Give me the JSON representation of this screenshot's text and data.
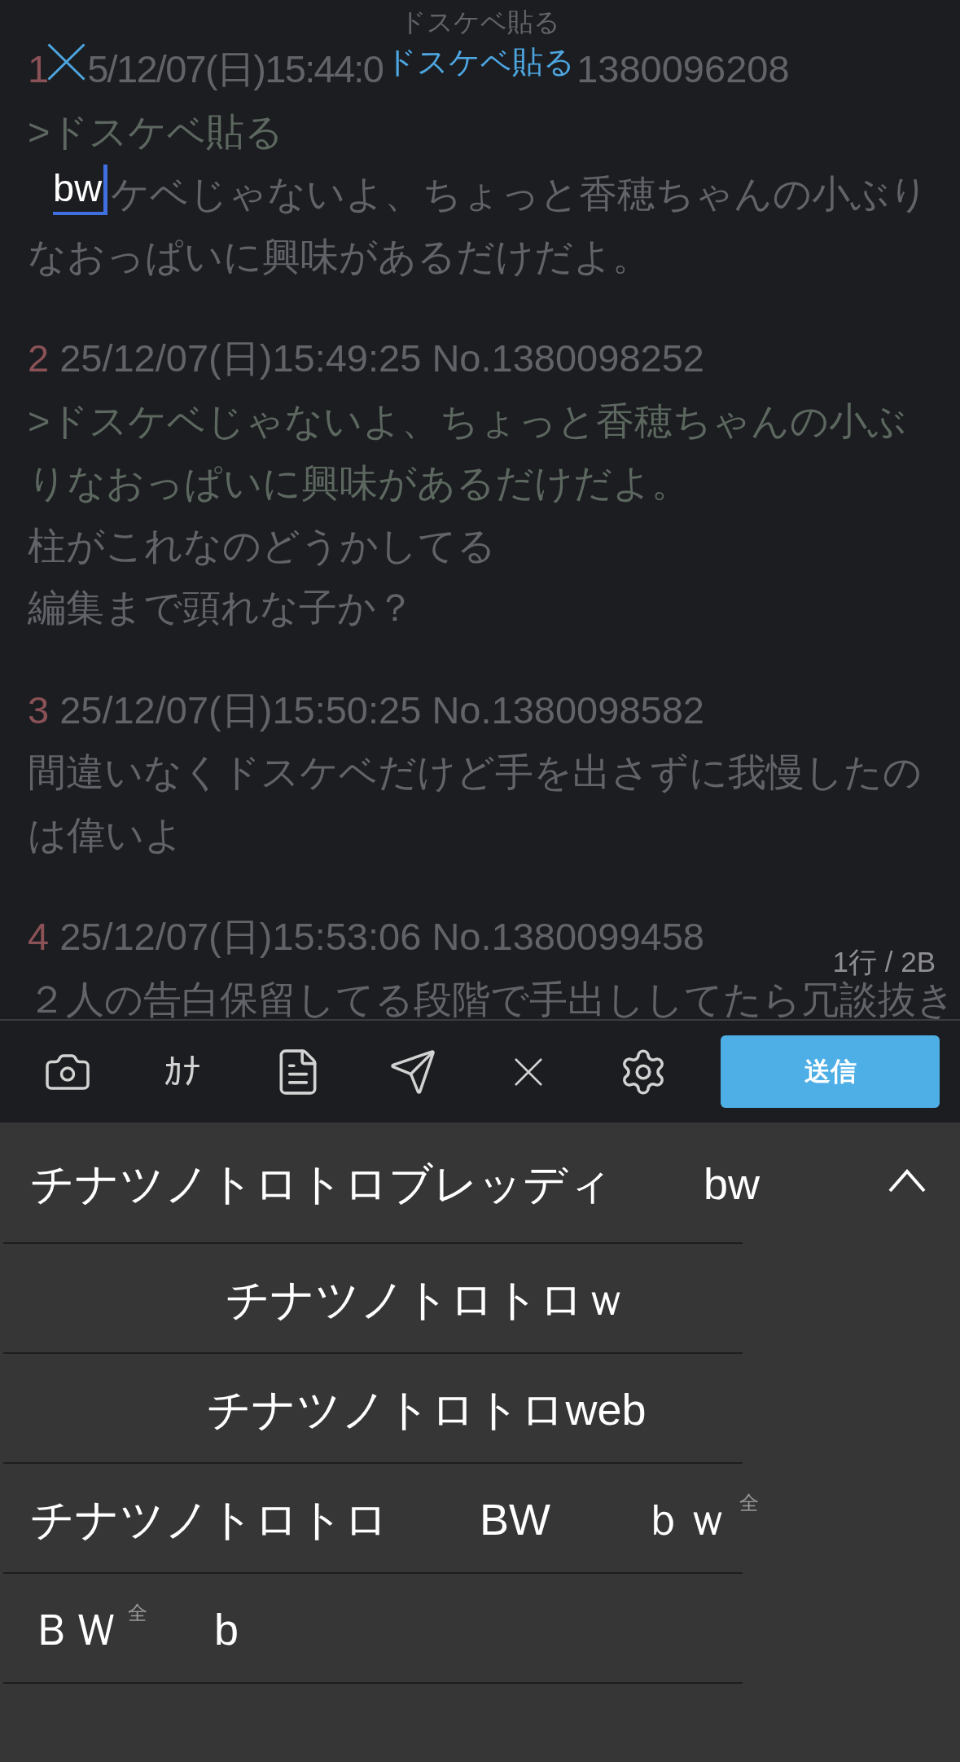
{
  "thread": {
    "title": "ドスケベ貼る",
    "posts": [
      {
        "number": "1",
        "info": [
          "5/12/07(日)15:44:0",
          "1380096208"
        ],
        "lines": [
          {
            "kind": "quote",
            "text": ">ドスケベ貼る"
          },
          {
            "kind": "text",
            "text": "ケベじゃないよ、ちょっと香穂ちゃんの小ぶり"
          },
          {
            "kind": "text",
            "text": "なおっぱいに興味があるだけだよ。"
          }
        ]
      },
      {
        "number": "2",
        "info": [
          "25/12/07(日)15:49:25 No.1380098252"
        ],
        "lines": [
          {
            "kind": "quote",
            "text": ">ドスケベじゃないよ、ちょっと香穂ちゃんの小ぶ"
          },
          {
            "kind": "quote",
            "text": "りなおっぱいに興味があるだけだよ。"
          },
          {
            "kind": "text",
            "text": "柱がこれなのどうかしてる"
          },
          {
            "kind": "text",
            "text": "編集まで頭れな子か？"
          }
        ]
      },
      {
        "number": "3",
        "info": [
          "25/12/07(日)15:50:25 No.1380098582"
        ],
        "lines": [
          {
            "kind": "text",
            "text": "間違いなくドスケベだけど手を出さずに我慢したの"
          },
          {
            "kind": "text",
            "text": "は偉いよ"
          }
        ]
      },
      {
        "number": "4",
        "info": [
          "25/12/07(日)15:53:06 No.1380099458"
        ],
        "lines": [
          {
            "kind": "text",
            "text": "２人の告白保留してる段階で手出ししてたら冗談抜き"
          }
        ]
      }
    ]
  },
  "reply": {
    "title": "ドスケベ貼る",
    "input": {
      "value": "bw",
      "composing": true
    },
    "counter": "1行 / 2B"
  },
  "toolbar": {
    "tools": [
      {
        "kind": "camera"
      },
      {
        "kind": "kana",
        "label": "ｶﾅ"
      },
      {
        "kind": "document"
      },
      {
        "kind": "send"
      },
      {
        "kind": "clear"
      },
      {
        "kind": "settings"
      }
    ],
    "submit_button": "送信"
  },
  "candidates": {
    "expanded": true,
    "rows": [
      {
        "items": [
          {
            "text": "チナツノトロトロブレッディ"
          },
          {
            "text": "bw"
          }
        ]
      },
      {
        "items": [
          {
            "text": "チナツノトロトロｗ"
          }
        ]
      },
      {
        "items": [
          {
            "text": "チナツノトロトロweb"
          }
        ]
      },
      {
        "items": [
          {
            "text": "チナツノトロトロ"
          },
          {
            "text": "BW"
          },
          {
            "text": "ｂｗ",
            "tag": "全"
          }
        ]
      },
      {
        "items": [
          {
            "text": "ＢＷ",
            "tag": "全"
          },
          {
            "text": "b"
          }
        ]
      }
    ]
  }
}
